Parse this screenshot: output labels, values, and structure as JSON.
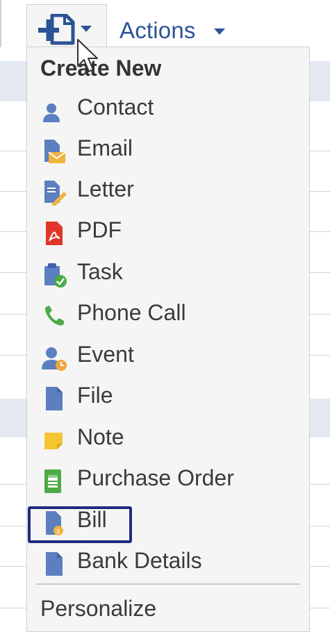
{
  "toolbar": {
    "new_icon": "new-document-plus-icon",
    "actions_label": "Actions"
  },
  "menu": {
    "header": "Create New",
    "items": [
      {
        "label": "Contact",
        "icon": "contact-icon"
      },
      {
        "label": "Email",
        "icon": "email-icon"
      },
      {
        "label": "Letter",
        "icon": "letter-icon"
      },
      {
        "label": "PDF",
        "icon": "pdf-icon"
      },
      {
        "label": "Task",
        "icon": "task-icon"
      },
      {
        "label": "Phone Call",
        "icon": "phone-call-icon"
      },
      {
        "label": "Event",
        "icon": "event-icon"
      },
      {
        "label": "File",
        "icon": "file-icon"
      },
      {
        "label": "Note",
        "icon": "note-icon"
      },
      {
        "label": "Purchase Order",
        "icon": "purchase-order-icon"
      },
      {
        "label": "Bill",
        "icon": "bill-icon"
      },
      {
        "label": "Bank Details",
        "icon": "bank-details-icon"
      }
    ],
    "highlighted_item": "Bill",
    "footer": "Personalize"
  },
  "colors": {
    "accent": "#2a5495",
    "icon_blue": "#5b7fc0",
    "highlight_border": "#1e2a80",
    "menu_bg": "#f5f5f5"
  }
}
